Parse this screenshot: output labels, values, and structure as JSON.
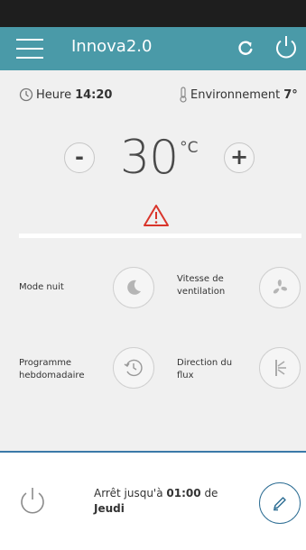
{
  "app": {
    "title": "Innova2.0"
  },
  "info": {
    "time_label": "Heure",
    "time_value": "14:20",
    "env_label": "Environnement",
    "env_value": "7°"
  },
  "temperature": {
    "value": "30",
    "unit": "°C",
    "minus": "-",
    "plus": "+"
  },
  "controls": {
    "night_mode": "Mode nuit",
    "fan_speed_line1": "Vitesse de",
    "fan_speed_line2": "ventilation",
    "weekly_line1": "Programme",
    "weekly_line2": "hebdomadaire",
    "flow_line1": "Direction du",
    "flow_line2": "flux"
  },
  "schedule": {
    "prefix": "Arrêt jusqu'à",
    "time": "01:00",
    "middle": "de",
    "day": "Jeudi"
  },
  "colors": {
    "appbar": "#4a9aa8",
    "warning": "#d9352b",
    "accent": "#2f6f95"
  },
  "icons": [
    "menu-icon",
    "refresh-icon",
    "power-icon",
    "clock-icon",
    "thermometer-icon",
    "warning-icon",
    "moon-icon",
    "fan-icon",
    "schedule-clock-icon",
    "airflow-icon",
    "pencil-icon"
  ]
}
